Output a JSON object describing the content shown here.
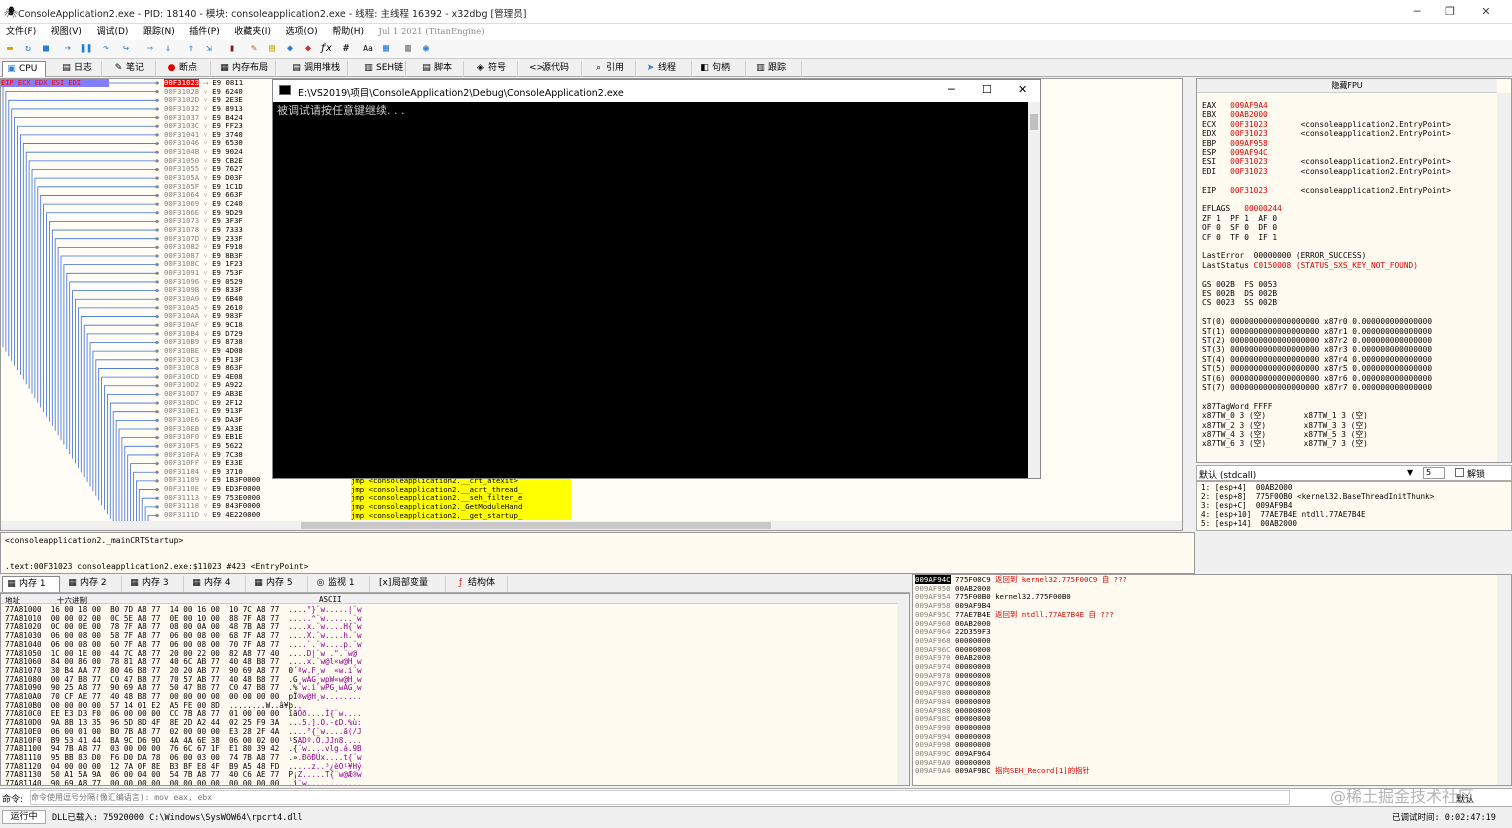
{
  "window": {
    "title": "ConsoleApplication2.exe - PID: 18140 - 模块: consoleapplication2.exe - 线程: 主线程 16392 - x32dbg [管理员]",
    "min": "─",
    "max": "❐",
    "close": "✕"
  },
  "menu": [
    "文件(F)",
    "视图(V)",
    "调试(D)",
    "跟踪(N)",
    "插件(P)",
    "收藏夹(I)",
    "选项(O)",
    "帮助(H)"
  ],
  "menu_date": "Jul 1 2021 (TitanEngine)",
  "tabs": [
    {
      "label": "CPU",
      "icon": "▣"
    },
    {
      "label": "日志",
      "icon": "▤"
    },
    {
      "label": "笔记",
      "icon": "✎"
    },
    {
      "label": "断点",
      "icon": "●"
    },
    {
      "label": "内存布局",
      "icon": "▦"
    },
    {
      "label": "调用堆栈",
      "icon": "▤"
    },
    {
      "label": "SEH链",
      "icon": "▥"
    },
    {
      "label": "脚本",
      "icon": "▤"
    },
    {
      "label": "符号",
      "icon": "◈"
    },
    {
      "label": "源代码",
      "icon": "<>"
    },
    {
      "label": "引用",
      "icon": "⌕"
    },
    {
      "label": "线程",
      "icon": "➤"
    },
    {
      "label": "句柄",
      "icon": "◧"
    },
    {
      "label": "跟踪",
      "icon": "▥"
    }
  ],
  "regbar_text": "EIP ECX EDX ESI EDI",
  "disasm": {
    "addresses": [
      "00F31023",
      "00F31028",
      "00F3102D",
      "00F31032",
      "00F31037",
      "00F3103C",
      "00F31041",
      "00F31046",
      "00F3104B",
      "00F31050",
      "00F31055",
      "00F3105A",
      "00F3105F",
      "00F31064",
      "00F31069",
      "00F3106E",
      "00F31073",
      "00F31078",
      "00F3107D",
      "00F31082",
      "00F31087",
      "00F3108C",
      "00F31091",
      "00F31096",
      "00F3109B",
      "00F310A0",
      "00F310A5",
      "00F310AA",
      "00F310AF",
      "00F310B4",
      "00F310B9",
      "00F310BE",
      "00F310C3",
      "00F310C8",
      "00F310CD",
      "00F310D2",
      "00F310D7",
      "00F310DC",
      "00F310E1",
      "00F310E6",
      "00F310EB",
      "00F310F0",
      "00F310F5",
      "00F310FA",
      "00F310FF",
      "00F31104",
      "00F31109",
      "00F3110E",
      "00F31113",
      "00F31118",
      "00F3111D"
    ],
    "bytes": [
      "E9 0811",
      "E9 6240",
      "E9 2E3E",
      "E9 8913",
      "E9 B424",
      "E9 FF23",
      "E9 3740",
      "E9 6530",
      "E9 9024",
      "E9 CB2E",
      "E9 7627",
      "E9 D03F",
      "E9 1C1D",
      "E9 663F",
      "E9 C240",
      "E9 9D29",
      "E9 3F3F",
      "E9 7333",
      "E9 233F",
      "E9 F918",
      "E9 8B3F",
      "E9 1F23",
      "E9 753F",
      "E9 0529",
      "E9 833F",
      "E9 6B40",
      "E9 2610",
      "E9 983F",
      "E9 9C18",
      "E9 D729",
      "E9 8738",
      "E9 4D08",
      "E9 F13F",
      "E9 863F",
      "E9 4E08",
      "E9 A922",
      "E9 AB3E",
      "E9 2F12",
      "E9 913F",
      "E9 DA3F",
      "E9 A33E",
      "E9 EB1E",
      "E9 5622",
      "E9 7C38",
      "E9 E33E",
      "E9 3710",
      "E9 1B3F0000",
      "E9 ED3F0000",
      "E9 753E0000",
      "E9 843F0000",
      "E9 4E220000"
    ],
    "jmps": [
      "jmp <consoleapplication2.__crt_atexit>",
      "jmp <consoleapplication2.__acrt_thread_",
      "jmp <consoleapplication2.__seh_filter_e",
      "jmp <consoleapplication2._GetModuleHand",
      "jmp <consoleapplication2.__get_startup_"
    ]
  },
  "console": {
    "title": "E:\\VS2019\\项目\\ConsoleApplication2\\Debug\\ConsoleApplication2.exe",
    "text": "被调试请按任意键继续. . ."
  },
  "registers": {
    "header": "隐藏FPU",
    "lines": [
      {
        "t": "EAX   009AF9A4",
        "red": true
      },
      {
        "t": "EBX   00AB2000",
        "red": true
      },
      {
        "t": "ECX   00F31023       <consoleapplication2.EntryPoint>",
        "red": false
      },
      {
        "t": "EDX   00F31023       <consoleapplication2.EntryPoint>",
        "red": false
      },
      {
        "t": "EBP   009AF958",
        "red": true
      },
      {
        "t": "ESP   009AF94C",
        "red": true
      },
      {
        "t": "ESI   00F31023       <consoleapplication2.EntryPoint>",
        "red": false
      },
      {
        "t": "EDI   00F31023       <consoleapplication2.EntryPoint>",
        "red": false
      },
      {
        "t": "",
        "red": false
      },
      {
        "t": "EIP   00F31023       <consoleapplication2.EntryPoint>",
        "red": false
      },
      {
        "t": "",
        "red": false
      },
      {
        "t": "EFLAGS   00000244",
        "red": false
      },
      {
        "t": "ZF 1  PF 1  AF 0",
        "red": false
      },
      {
        "t": "OF 0  SF 0  DF 0",
        "red": false
      },
      {
        "t": "CF 0  TF 0  IF 1",
        "red": false
      },
      {
        "t": "",
        "red": false
      },
      {
        "t": "LastError  00000000 (ERROR_SUCCESS)",
        "red": false
      },
      {
        "t": "LastStatus C0150008 (STATUS_SXS_KEY_NOT_FOUND)",
        "red": false
      },
      {
        "t": "",
        "red": false
      },
      {
        "t": "GS 002B  FS 0053",
        "red": false
      },
      {
        "t": "ES 002B  DS 002B",
        "red": false
      },
      {
        "t": "CS 0023  SS 002B",
        "red": false
      },
      {
        "t": "",
        "red": false
      },
      {
        "t": "ST(0) 0000000000000000000 x87r0 0.000000000000000",
        "red": false
      },
      {
        "t": "ST(1) 0000000000000000000 x87r1 0.000000000000000",
        "red": false
      },
      {
        "t": "ST(2) 0000000000000000000 x87r2 0.000000000000000",
        "red": false
      },
      {
        "t": "ST(3) 0000000000000000000 x87r3 0.000000000000000",
        "red": false
      },
      {
        "t": "ST(4) 0000000000000000000 x87r4 0.000000000000000",
        "red": false
      },
      {
        "t": "ST(5) 0000000000000000000 x87r5 0.000000000000000",
        "red": false
      },
      {
        "t": "ST(6) 0000000000000000000 x87r6 0.000000000000000",
        "red": false
      },
      {
        "t": "ST(7) 0000000000000000000 x87r7 0.000000000000000",
        "red": false
      },
      {
        "t": "",
        "red": false
      },
      {
        "t": "x87TagWord FFFF",
        "red": false
      },
      {
        "t": "x87TW_0 3 (空)        x87TW_1 3 (空)",
        "red": false
      },
      {
        "t": "x87TW_2 3 (空)        x87TW_3 3 (空)",
        "red": false
      },
      {
        "t": "x87TW_4 3 (空)        x87TW_5 3 (空)",
        "red": false
      },
      {
        "t": "x87TW_6 3 (空)        x87TW_7 3 (空)",
        "red": false
      }
    ]
  },
  "callconv": {
    "value": "默认 (stdcall)",
    "count": "5",
    "unlock": "解锁"
  },
  "stack_args": [
    "1: [esp+4]  00AB2000",
    "2: [esp+8]  775F00B0 <kernel32.BaseThreadInitThunk>",
    "3: [esp+C]  009AF9B4",
    "4: [esp+10]  77AE7B4E ntdll.77AE7B4E",
    "5: [esp+14]  00AB2000"
  ],
  "info": {
    "line1": "<consoleapplication2._mainCRTStartup>",
    "line2": ".text:00F31023 consoleapplication2.exe:$11023 #423 <EntryPoint>"
  },
  "mem_tabs": [
    "内存 1",
    "内存 2",
    "内存 3",
    "内存 4",
    "内存 5",
    "监视 1",
    "局部变量",
    "结构体"
  ],
  "dump_headers": {
    "addr": "地址",
    "hex": "十六进制",
    "ascii": "ASCII"
  },
  "dump_rows": [
    "77A81000  16 00 18 00  B0 7D A8 77  14 00 16 00  10 7C A8 77  ....°}¨w.....|¨w",
    "77A81010  00 00 02 00  0C 5E A8 77  0E 00 10 00  88 7F A8 77  .....^¨w......¨w",
    "77A81020  0C 00 0E 00  78 7F A8 77  08 00 0A 00  48 7B A8 77  ....x.¨w....H{¨w",
    "77A81030  06 00 08 00  58 7F A8 77  06 00 08 00  68 7F A8 77  ....X.¨w....h.¨w",
    "77A81040  06 00 08 00  60 7F A8 77  06 00 08 00  70 7F A8 77  ....`.¨w....p.¨w",
    "77A81050  1C 00 1E 00  44 7C A8 77  20 00 22 00  82 A8 77 40  ....D|¨w .\".¨w@",
    "77A81060  84 00 86 00  78 81 A8 77  40 6C AB 77  40 48 B8 77  ....x.¨w@l«w@H¸w",
    "77A81070  30 B4 AA 77  80 46 B8 77  20 20 AB 77  90 69 A8 77  0´ªw.F¸w  «w.i¨w",
    "77A81080  00 47 B8 77  C0 47 B8 77  70 57 AB 77  40 48 B8 77  .G¸wÀG¸wpW«w@H¸w",
    "77A81090  90 25 A8 77  90 69 A8 77  50 47 B8 77  C0 47 B8 77  .%¨w.i¨wPG¸wÀG¸w",
    "77A810A0  70 CF AE 77  40 48 B8 77  00 00 00 00  00 00 00 00  pÏ®w@H¸w........",
    "77A810B0  00 00 00 00  57 14 01 E2  A5 FE 00 8D  ........W..â¥þ..",
    "77A810C0  EE E3 D3 F0  06 00 00 00  CC 7B A8 77  01 00 00 00  îãÓð....Ì{¨w....",
    "77A810D0  9A 8B 13 35  96 5D 8D 4F  8E 2D A2 44  02 25 F9 3A  ...5.].O.-¢D.%ù:",
    "77A810E0  06 00 01 00  B0 7B A8 77  02 00 00 00  E3 28 2F 4A  ....°{¨w....ã(/J",
    "77A810F0  B9 53 41 44  BA 9C D6 9D  4A 4A 6E 38  06 00 02 00  ¹SADº.Ö.JJn8....",
    "77A81100  94 7B A8 77  03 00 00 00  76 6C 67 1F  E1 80 39 42  .{¨w....vlg.á.9B",
    "77A81110  95 BB 83 D0  F6 D0 DA 78  06 00 03 00  74 7B A8 77  .».ÐöÐÚx....t{¨w",
    "77A81120  04 00 00 00  12 7A 0F 8E  B3 BF E8 4F  B9 A5 48 FD  .....z..³¿èO¹¥Hý",
    "77A81130  50 A1 5A 9A  06 00 04 00  54 7B A8 77  40 C6 AE 77  P¡Z.....T{¨w@Æ®w",
    "77A81140  90 69 A8 77  00 00 00 00  00 00 00 00  00 00 00 00  .i¨w............"
  ],
  "stack_rows": [
    {
      "a": "009AF94C",
      "v": "775F00C9",
      "c": "返回到 kernel32.775F00C9 自 ???",
      "cur": true
    },
    {
      "a": "009AF950",
      "v": "00AB2000",
      "c": ""
    },
    {
      "a": "009AF954",
      "v": "775F00B0",
      "c": "kernel32.775F00B0"
    },
    {
      "a": "009AF958",
      "v": "009AF9B4",
      "c": ""
    },
    {
      "a": "009AF95C",
      "v": "77AE7B4E",
      "c": "返回到 ntdll.77AE7B4E 自 ???"
    },
    {
      "a": "009AF960",
      "v": "00AB2000",
      "c": ""
    },
    {
      "a": "009AF964",
      "v": "22D359F3",
      "c": ""
    },
    {
      "a": "009AF968",
      "v": "00000000",
      "c": ""
    },
    {
      "a": "009AF96C",
      "v": "00000000",
      "c": ""
    },
    {
      "a": "009AF970",
      "v": "00AB2000",
      "c": ""
    },
    {
      "a": "009AF974",
      "v": "00000000",
      "c": ""
    },
    {
      "a": "009AF978",
      "v": "00000000",
      "c": ""
    },
    {
      "a": "009AF97C",
      "v": "00000000",
      "c": ""
    },
    {
      "a": "009AF980",
      "v": "00000000",
      "c": ""
    },
    {
      "a": "009AF984",
      "v": "00000000",
      "c": ""
    },
    {
      "a": "009AF988",
      "v": "00000000",
      "c": ""
    },
    {
      "a": "009AF98C",
      "v": "00000000",
      "c": ""
    },
    {
      "a": "009AF990",
      "v": "00000000",
      "c": ""
    },
    {
      "a": "009AF994",
      "v": "00000000",
      "c": ""
    },
    {
      "a": "009AF998",
      "v": "00000000",
      "c": ""
    },
    {
      "a": "009AF99C",
      "v": "009AF964",
      "c": ""
    },
    {
      "a": "009AF9A0",
      "v": "00000000",
      "c": ""
    },
    {
      "a": "009AF9A4",
      "v": "009AF9BC",
      "c": "指向SEH_Record[1]的指针"
    }
  ],
  "command": {
    "label": "命令:",
    "placeholder": "命令使用逗号分隔(像汇编语言): mov eax, ebx",
    "mode": "默认"
  },
  "status": {
    "state": "运行中",
    "msg": "DLL已载入:  75920000 C:\\Windows\\SysWOW64\\rpcrt4.dll",
    "time": "已调试时间:  0:02:47:19"
  },
  "watermark": "@稀土掘金技术社区"
}
